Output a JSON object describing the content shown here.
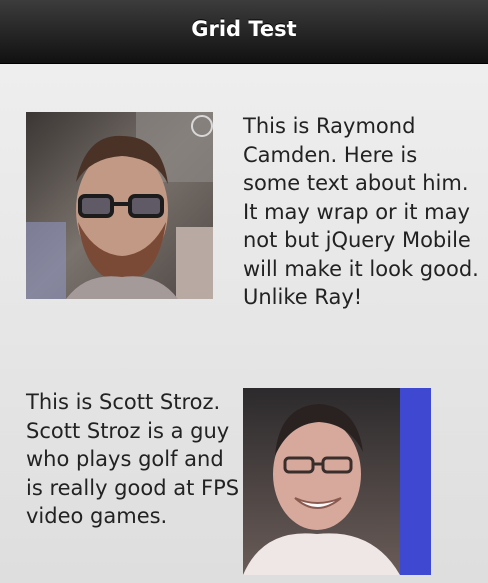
{
  "header": {
    "title": "Grid Test"
  },
  "people": [
    {
      "text": "This is Raymond Camden. Here is some text about him. It may wrap or it may not but jQuery Mobile will make it look good. Unlike Ray!"
    },
    {
      "text": "This is Scott Stroz. Scott Stroz is a guy who plays golf and is really good at FPS video games."
    }
  ],
  "colors": {
    "header_top": "#3c3c3c",
    "header_bottom": "#111111",
    "page_background": "#e6e6e6",
    "text": "#222222",
    "photo_side_band": "#3f48d0"
  }
}
